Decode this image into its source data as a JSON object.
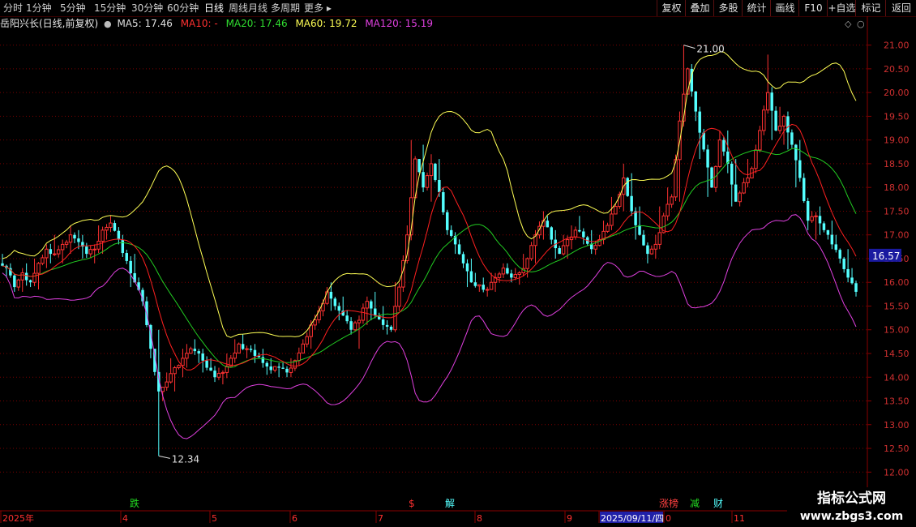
{
  "toolbar": {
    "periods": [
      "分时",
      "1分钟",
      "5分钟",
      "15分钟",
      "30分钟",
      "60分钟",
      "日线",
      "周线",
      "月线",
      "多周期",
      "更多"
    ],
    "active_period": "日线",
    "right_buttons": [
      "复权",
      "叠加",
      "多股",
      "统计",
      "画线",
      "F10",
      "+自选",
      "标记",
      "返回"
    ]
  },
  "info": {
    "title": "岳阳兴长(日线,前复权)",
    "ma5": "MA5: 17.46",
    "ma10": "MA10: -",
    "ma20": "MA20: 17.46",
    "ma60": "MA60: 19.72",
    "ma120": "MA120: 15.19"
  },
  "colors": {
    "up": "#ff3232",
    "down": "#54ffff",
    "ma20": "#ffff55",
    "ma60": "#22cc22",
    "ma120": "#e040e0",
    "ma5": "#ff2020",
    "grid": "#7a0000"
  },
  "chart_data": {
    "type": "candlestick",
    "ylim": [
      11.8,
      21.25
    ],
    "y_ticks": [
      21.0,
      20.5,
      20.0,
      19.5,
      19.0,
      18.5,
      18.0,
      17.5,
      17.0,
      16.5,
      16.0,
      15.5,
      15.0,
      14.5,
      14.0,
      13.5,
      13.0,
      12.5,
      12.0
    ],
    "current_price": "16.57",
    "max_label": "21.00",
    "min_label": "12.34",
    "x_axis_labels": [
      "2025年",
      "4",
      "5",
      "6",
      "7",
      "8",
      "9",
      "2025/09/11/四",
      "0",
      "11"
    ],
    "event_markers": [
      "跌",
      "$",
      "解",
      "涨榜",
      "减",
      "财"
    ],
    "ohlc_anchors": [
      [
        16.4,
        16.6,
        16.1,
        16.3
      ],
      [
        16.3,
        16.4,
        15.8,
        15.9
      ],
      [
        15.9,
        16.3,
        15.8,
        16.2
      ],
      [
        16.2,
        16.4,
        15.9,
        16.0
      ],
      [
        16.0,
        16.5,
        15.85,
        16.4
      ],
      [
        16.4,
        16.8,
        16.3,
        16.7
      ],
      [
        16.7,
        17.0,
        16.4,
        16.6
      ],
      [
        16.6,
        16.9,
        16.4,
        16.8
      ],
      [
        16.8,
        17.2,
        16.6,
        17.0
      ],
      [
        17.0,
        17.1,
        16.7,
        16.85
      ],
      [
        16.85,
        17.0,
        16.5,
        16.6
      ],
      [
        16.6,
        16.8,
        16.4,
        16.7
      ],
      [
        16.7,
        17.2,
        16.6,
        17.1
      ],
      [
        17.1,
        17.4,
        16.9,
        17.25
      ],
      [
        17.25,
        17.3,
        16.8,
        16.9
      ],
      [
        16.9,
        17.0,
        16.4,
        16.45
      ],
      [
        16.45,
        16.6,
        15.9,
        16.0
      ],
      [
        16.0,
        16.1,
        15.5,
        15.6
      ],
      [
        15.6,
        15.7,
        14.4,
        14.6
      ],
      [
        14.6,
        15.0,
        12.34,
        13.7
      ],
      [
        13.7,
        14.1,
        13.5,
        13.9
      ],
      [
        13.9,
        14.4,
        13.7,
        14.2
      ],
      [
        14.2,
        14.6,
        14.0,
        14.4
      ],
      [
        14.4,
        14.7,
        14.2,
        14.6
      ],
      [
        14.6,
        14.8,
        14.3,
        14.5
      ],
      [
        14.5,
        14.6,
        14.1,
        14.2
      ],
      [
        14.2,
        14.4,
        13.9,
        14.0
      ],
      [
        14.0,
        14.2,
        13.85,
        14.1
      ],
      [
        14.1,
        14.5,
        14.0,
        14.4
      ],
      [
        14.4,
        14.8,
        14.3,
        14.7
      ],
      [
        14.7,
        14.9,
        14.4,
        14.6
      ],
      [
        14.6,
        14.7,
        14.3,
        14.45
      ],
      [
        14.45,
        14.6,
        14.2,
        14.3
      ],
      [
        14.3,
        14.4,
        14.05,
        14.15
      ],
      [
        14.15,
        14.3,
        14.0,
        14.2
      ],
      [
        14.2,
        14.3,
        14.0,
        14.1
      ],
      [
        14.1,
        14.4,
        14.0,
        14.35
      ],
      [
        14.35,
        14.8,
        14.3,
        14.7
      ],
      [
        14.7,
        15.2,
        14.6,
        15.1
      ],
      [
        15.1,
        15.5,
        15.0,
        15.4
      ],
      [
        15.4,
        15.9,
        15.3,
        15.8
      ],
      [
        15.8,
        16.0,
        15.4,
        15.5
      ],
      [
        15.5,
        15.7,
        15.2,
        15.3
      ],
      [
        15.3,
        15.4,
        14.9,
        15.0
      ],
      [
        15.0,
        15.3,
        14.6,
        15.2
      ],
      [
        15.2,
        15.7,
        15.1,
        15.6
      ],
      [
        15.6,
        15.8,
        15.2,
        15.3
      ],
      [
        15.3,
        15.5,
        15.0,
        15.1
      ],
      [
        15.1,
        15.2,
        14.9,
        15.0
      ],
      [
        15.0,
        16.0,
        14.95,
        15.9
      ],
      [
        15.9,
        17.2,
        15.8,
        17.0
      ],
      [
        17.0,
        19.0,
        16.9,
        18.6
      ],
      [
        18.6,
        18.9,
        17.9,
        18.0
      ],
      [
        18.0,
        18.7,
        17.7,
        18.5
      ],
      [
        18.5,
        18.6,
        17.8,
        17.9
      ],
      [
        17.9,
        18.0,
        17.0,
        17.1
      ],
      [
        17.1,
        17.2,
        16.6,
        16.8
      ],
      [
        16.8,
        16.9,
        16.3,
        16.4
      ],
      [
        16.4,
        16.5,
        15.9,
        16.0
      ],
      [
        16.0,
        16.2,
        15.8,
        15.95
      ],
      [
        15.95,
        16.1,
        15.7,
        15.85
      ],
      [
        15.85,
        16.2,
        15.8,
        16.1
      ],
      [
        16.1,
        16.4,
        16.0,
        16.3
      ],
      [
        16.3,
        16.4,
        16.0,
        16.1
      ],
      [
        16.1,
        16.3,
        15.95,
        16.2
      ],
      [
        16.2,
        16.6,
        16.1,
        16.5
      ],
      [
        16.5,
        17.1,
        16.4,
        17.0
      ],
      [
        17.0,
        17.5,
        16.9,
        17.3
      ],
      [
        17.3,
        17.4,
        16.8,
        16.9
      ],
      [
        16.9,
        17.1,
        16.5,
        16.6
      ],
      [
        16.6,
        17.0,
        16.5,
        16.9
      ],
      [
        16.9,
        17.2,
        16.7,
        17.1
      ],
      [
        17.1,
        17.4,
        16.8,
        16.95
      ],
      [
        16.95,
        17.1,
        16.6,
        16.7
      ],
      [
        16.7,
        17.0,
        16.6,
        16.9
      ],
      [
        16.9,
        17.3,
        16.8,
        17.2
      ],
      [
        17.2,
        17.8,
        17.1,
        17.6
      ],
      [
        17.6,
        18.5,
        17.5,
        18.2
      ],
      [
        18.2,
        18.3,
        17.4,
        17.5
      ],
      [
        17.5,
        17.6,
        16.9,
        17.0
      ],
      [
        17.0,
        17.1,
        16.4,
        16.6
      ],
      [
        16.6,
        17.0,
        16.5,
        16.8
      ],
      [
        16.8,
        17.6,
        16.7,
        17.4
      ],
      [
        17.4,
        18.0,
        17.3,
        17.8
      ],
      [
        17.8,
        19.6,
        17.7,
        19.4
      ],
      [
        19.4,
        21.0,
        19.3,
        20.5
      ],
      [
        20.5,
        20.6,
        19.4,
        19.6
      ],
      [
        19.6,
        19.7,
        18.6,
        18.8
      ],
      [
        18.8,
        18.9,
        17.8,
        18.0
      ],
      [
        18.0,
        19.2,
        17.9,
        19.0
      ],
      [
        19.0,
        19.2,
        18.3,
        18.5
      ],
      [
        18.5,
        18.6,
        17.6,
        17.7
      ],
      [
        17.7,
        18.2,
        17.6,
        18.1
      ],
      [
        18.1,
        18.6,
        18.0,
        18.4
      ],
      [
        18.4,
        19.3,
        18.3,
        19.2
      ],
      [
        19.2,
        20.8,
        19.1,
        20.0
      ],
      [
        20.0,
        20.1,
        19.0,
        19.2
      ],
      [
        19.2,
        19.7,
        18.9,
        19.5
      ],
      [
        19.5,
        19.6,
        18.8,
        18.9
      ],
      [
        18.9,
        19.0,
        18.0,
        18.2
      ],
      [
        18.2,
        18.3,
        17.1,
        17.3
      ],
      [
        17.3,
        17.5,
        16.9,
        17.4
      ],
      [
        17.4,
        17.6,
        17.0,
        17.1
      ],
      [
        17.1,
        17.3,
        16.7,
        16.8
      ],
      [
        16.8,
        17.0,
        16.4,
        16.5
      ],
      [
        16.5,
        16.7,
        16.0,
        16.1
      ],
      [
        16.1,
        16.3,
        15.7,
        15.8
      ]
    ]
  },
  "watermark": {
    "line1": "指标公式网",
    "line2": "www.zbgs3.com"
  }
}
